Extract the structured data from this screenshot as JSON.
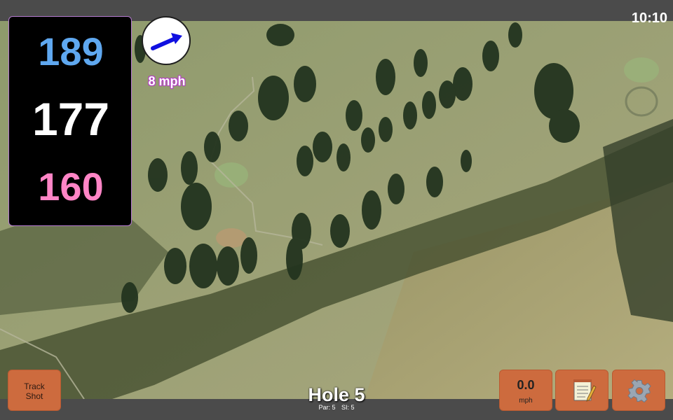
{
  "status": {
    "time": "10:10"
  },
  "distances": {
    "back": "189",
    "middle": "177",
    "front": "160"
  },
  "wind": {
    "speed_label": "8 mph",
    "arrow_icon": "wind-arrow-icon"
  },
  "buttons": {
    "track_shot_line1": "Track",
    "track_shot_line2": "Shot",
    "speed_value": "0.0",
    "speed_unit": "mph",
    "notes_icon": "notepad-icon",
    "settings_icon": "gear-icon"
  },
  "hole": {
    "title": "Hole 5",
    "par": "Par: 5",
    "si": "SI: 5"
  },
  "colors": {
    "back_distance": "#5fa8f0",
    "middle_distance": "#ffffff",
    "front_distance": "#ff85c6",
    "button": "#cd6b3e",
    "wind_arrow": "#1010e0"
  }
}
